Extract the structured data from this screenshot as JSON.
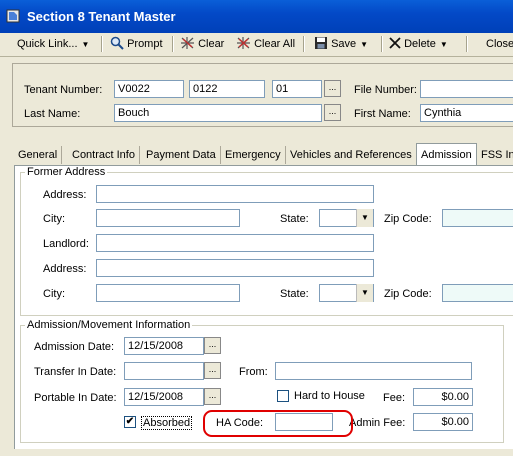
{
  "window": {
    "title": "Section 8 Tenant Master",
    "app_icon": "app-icon"
  },
  "toolbar": {
    "quick_link": "Quick Link...",
    "prompt": "Prompt",
    "clear": "Clear",
    "clear_all": "Clear All",
    "save": "Save",
    "delete": "Delete",
    "close": "Close"
  },
  "header": {
    "tenant_number_label": "Tenant Number:",
    "tenant_number_1": "V0022",
    "tenant_number_2": "0122",
    "tenant_number_3": "01",
    "file_number_label": "File Number:",
    "file_number": "",
    "last_name_label": "Last Name:",
    "last_name": "Bouch",
    "first_name_label": "First Name:",
    "first_name": "Cynthia",
    "ellipsis": "..."
  },
  "tabs": [
    {
      "label": "General"
    },
    {
      "label": "Contract Info"
    },
    {
      "label": "Payment Data"
    },
    {
      "label": "Emergency"
    },
    {
      "label": "Vehicles and References"
    },
    {
      "label": "Admission",
      "active": true
    },
    {
      "label": "FSS In"
    }
  ],
  "former_address": {
    "legend": "Former Address",
    "address_label": "Address:",
    "city_label": "City:",
    "state_label": "State:",
    "zip_label": "Zip Code:",
    "landlord_label": "Landlord:",
    "address2_label": "Address:",
    "city2_label": "City:",
    "state2_label": "State:",
    "zip2_label": "Zip Code:"
  },
  "admission": {
    "legend": "Admission/Movement Information",
    "admission_date_label": "Admission Date:",
    "admission_date": "12/15/2008",
    "transfer_in_label": "Transfer In Date:",
    "transfer_in_date": "",
    "from_label": "From:",
    "from_value": "",
    "portable_in_label": "Portable In Date:",
    "portable_in_date": "12/15/2008",
    "hard_to_house_label": "Hard to House",
    "fee_label": "Fee:",
    "fee_value": "$0.00",
    "absorbed_label": "Absorbed",
    "absorbed_check": "✔",
    "ha_code_label": "HA Code:",
    "ha_code_value": "",
    "admin_fee_label": "Admin Fee:",
    "admin_fee_value": "$0.00"
  },
  "glyphs": {
    "dropdown": "▼",
    "menu_caret": "▼"
  },
  "colors": {
    "title_bar": "#0349c7",
    "highlight_circle": "#e00000",
    "readonly_field": "#eefaf8"
  }
}
